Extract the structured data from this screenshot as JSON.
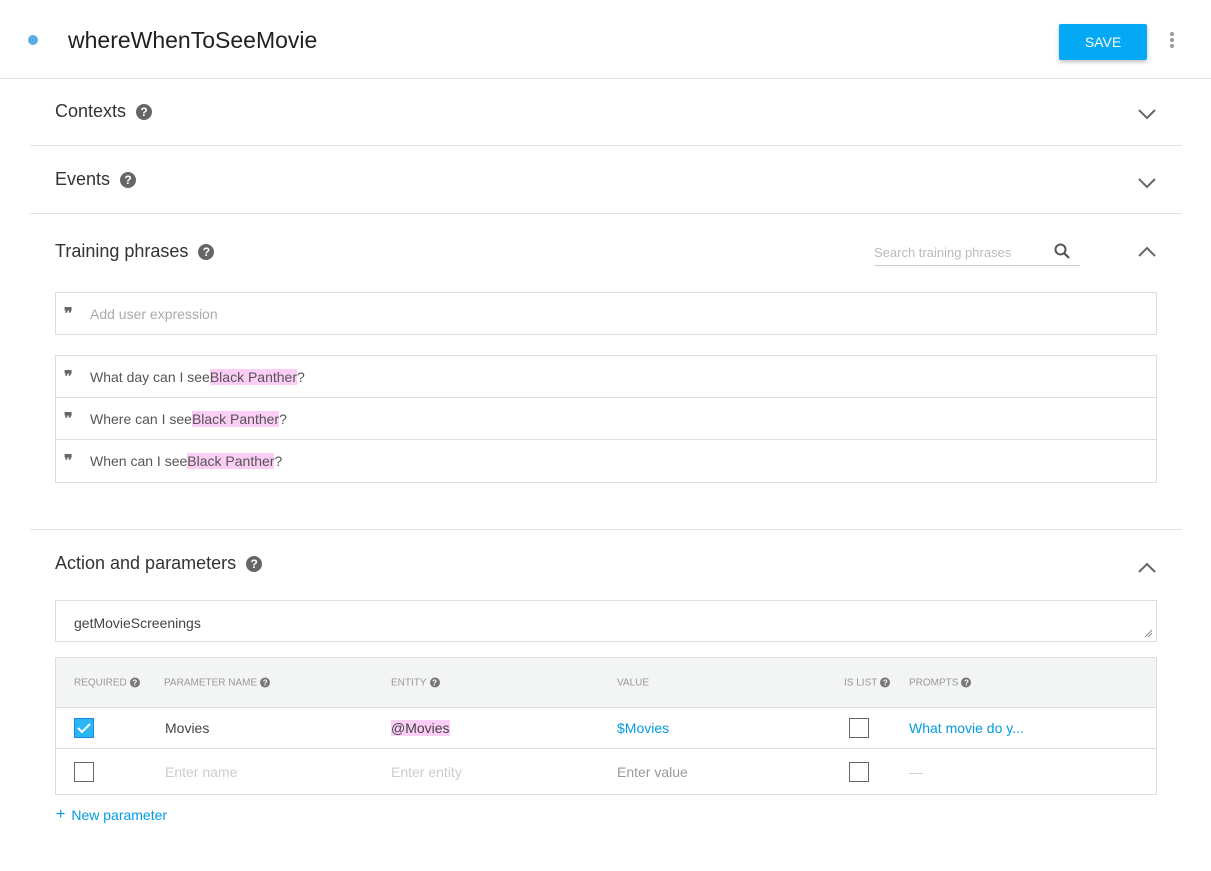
{
  "header": {
    "title": "whereWhenToSeeMovie",
    "save_label": "SAVE",
    "status_color": "#5aace8",
    "accent": "#03a9f4"
  },
  "sections": {
    "contexts": {
      "title": "Contexts"
    },
    "events": {
      "title": "Events"
    },
    "training": {
      "title": "Training phrases",
      "search_placeholder": "Search training phrases",
      "add_placeholder": "Add user expression",
      "phrases": [
        {
          "before": "What day can I see ",
          "entity": "Black Panther",
          "after": "?"
        },
        {
          "before": "Where can I see ",
          "entity": "Black Panther",
          "after": "?"
        },
        {
          "before": "When can I see ",
          "entity": "Black Panther",
          "after": "?"
        }
      ]
    },
    "action": {
      "title": "Action and parameters",
      "action_name": "getMovieScreenings",
      "columns": [
        "REQUIRED",
        "PARAMETER NAME",
        "ENTITY",
        "VALUE",
        "IS LIST",
        "PROMPTS"
      ],
      "rows": [
        {
          "required": true,
          "name": "Movies",
          "entity": "@Movies",
          "value": "$Movies",
          "is_list": false,
          "prompts": "What movie do y..."
        },
        {
          "required": false,
          "name": "Enter name",
          "entity": "Enter entity",
          "value": "Enter value",
          "is_list": false,
          "prompts": "—"
        }
      ],
      "new_parameter": "New parameter",
      "new_icon": "+"
    }
  }
}
